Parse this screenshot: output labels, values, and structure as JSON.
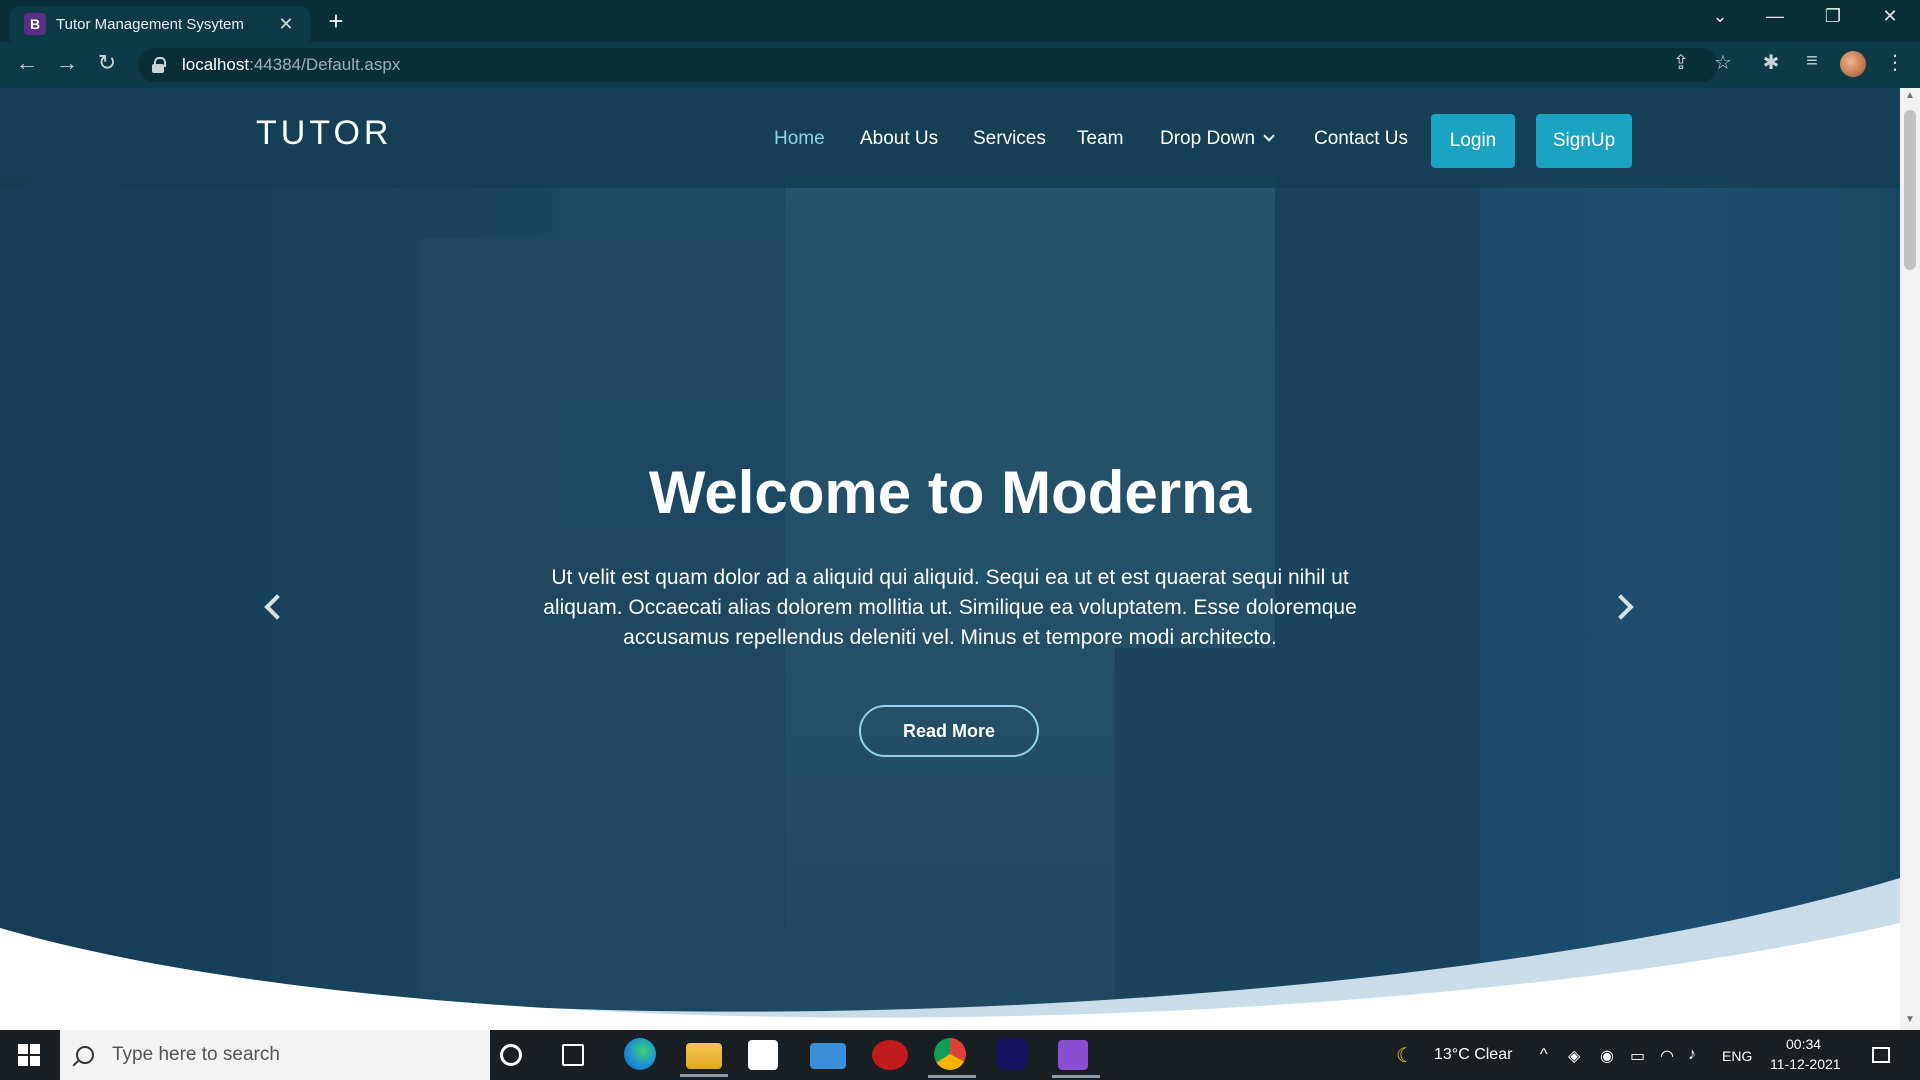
{
  "browser": {
    "tab": {
      "favicon_letter": "B",
      "title": "Tutor Management Sysytem",
      "close": "✕"
    },
    "new_tab": "+",
    "window_controls": {
      "dropdown": "⌄",
      "minimize": "—",
      "restore": "❐",
      "close": "✕"
    },
    "nav": {
      "back": "←",
      "forward": "→",
      "reload": "↻"
    },
    "url": {
      "host": "localhost",
      "path": ":44384/Default.aspx"
    },
    "toolbar_icons": {
      "share": "⇪",
      "star": "☆",
      "extensions": "✱",
      "media": "≡",
      "menu": "⋮"
    }
  },
  "site": {
    "logo": "TUTOR",
    "nav": [
      {
        "label": "Home",
        "active": true
      },
      {
        "label": "About Us"
      },
      {
        "label": "Services"
      },
      {
        "label": "Team"
      },
      {
        "label": "Drop Down"
      },
      {
        "label": "Contact Us"
      }
    ],
    "login_label": "Login",
    "signup_label": "SignUp",
    "hero": {
      "title": "Welcome to Moderna",
      "text": "Ut velit est quam dolor ad a aliquid qui aliquid. Sequi ea ut et est quaerat sequi nihil ut aliquam. Occaecati alias dolorem mollitia ut. Similique ea voluptatem. Esse doloremque accusamus repellendus deleniti vel. Minus et tempore modi architecto.",
      "button": "Read More"
    }
  },
  "taskbar": {
    "search_placeholder": "Type here to search",
    "weather": "13°C  Clear",
    "lang": "ENG",
    "time": "00:34",
    "date": "11-12-2021"
  },
  "colors": {
    "chrome": "#0d3b45",
    "header": "#143e52",
    "accent": "#1aa3c2",
    "active_nav": "#8fd3ea",
    "wave": "#c9dce8"
  }
}
